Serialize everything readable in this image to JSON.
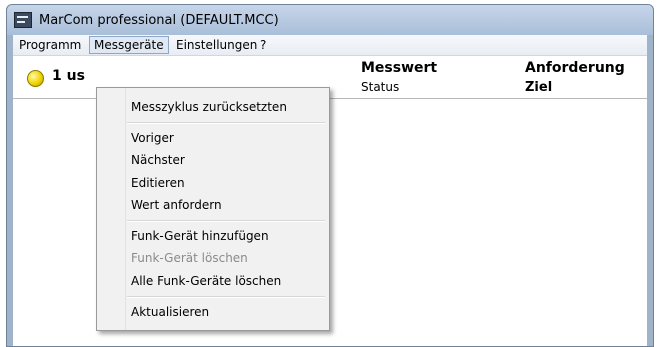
{
  "window": {
    "title": "MarCom professional   (DEFAULT.MCC)",
    "app_icon": "app-logo-icon"
  },
  "menubar": {
    "items": [
      {
        "label": "Programm"
      },
      {
        "label": "Messgeräte",
        "active": true
      },
      {
        "label": "Einstellungen"
      },
      {
        "label": "?"
      }
    ]
  },
  "header": {
    "device_label": "1 us",
    "led_color": "#f0d400",
    "col1_title": "Messwert",
    "col1_sub": "Status",
    "col2_title": "Anforderung",
    "col2_sub": "Ziel"
  },
  "dropdown": {
    "items": [
      {
        "label": "Messzyklus zurücksetzten",
        "enabled": true
      },
      {
        "label": "Voriger",
        "enabled": true
      },
      {
        "label": "Nächster",
        "enabled": true
      },
      {
        "label": "Editieren",
        "enabled": true
      },
      {
        "label": "Wert anfordern",
        "enabled": true
      },
      {
        "label": "Funk-Gerät hinzufügen",
        "enabled": true
      },
      {
        "label": "Funk-Gerät löschen",
        "enabled": false
      },
      {
        "label": "Alle Funk-Geräte löschen",
        "enabled": true
      },
      {
        "label": "Aktualisieren",
        "enabled": true
      }
    ]
  }
}
